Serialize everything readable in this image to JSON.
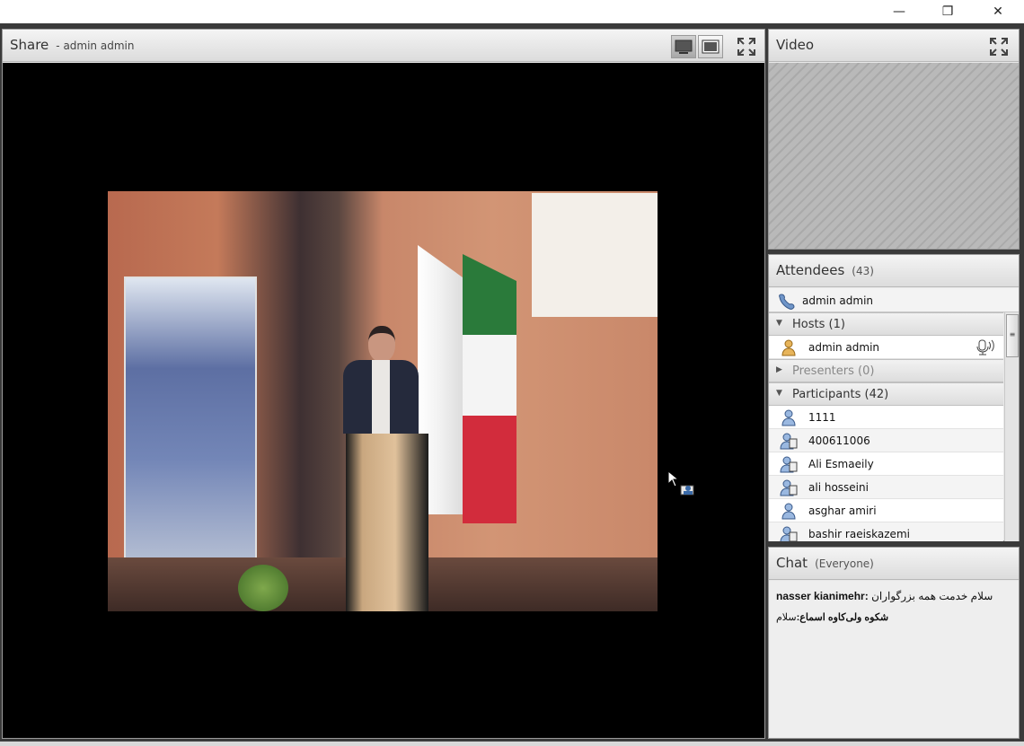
{
  "window": {
    "minimize_glyph": "—",
    "restore_glyph": "❐",
    "close_glyph": "✕"
  },
  "share": {
    "title": "Share",
    "presenter": "- admin admin"
  },
  "video": {
    "title": "Video"
  },
  "attendees": {
    "title": "Attendees",
    "count": "(43)",
    "me": "admin admin",
    "hosts_label": "Hosts (1)",
    "hosts": [
      {
        "name": "admin admin",
        "icon": "host-icon"
      }
    ],
    "presenters_label": "Presenters (0)",
    "participants_label": "Participants (42)",
    "participants": [
      {
        "name": "1111",
        "icon": "participant-icon"
      },
      {
        "name": "400611006",
        "icon": "participant-device-icon"
      },
      {
        "name": "Ali Esmaeily",
        "icon": "participant-device-icon"
      },
      {
        "name": "ali hosseini",
        "icon": "participant-device-icon"
      },
      {
        "name": "asghar amiri",
        "icon": "participant-icon"
      },
      {
        "name": "bashir raeiskazemi",
        "icon": "participant-device-icon"
      }
    ]
  },
  "chat": {
    "title": "Chat",
    "audience": "(Everyone)",
    "messages": [
      {
        "sender": "nasser kianimehr:",
        "text": " سلام خدمت همه بزرگواران"
      },
      {
        "sender": "شکوه ولی‌کاوه اسماع:",
        "text": "سلام "
      }
    ]
  },
  "colors": {
    "frame": "#3a3a3a",
    "stage": "#000000",
    "header": "#e0e0e0"
  }
}
